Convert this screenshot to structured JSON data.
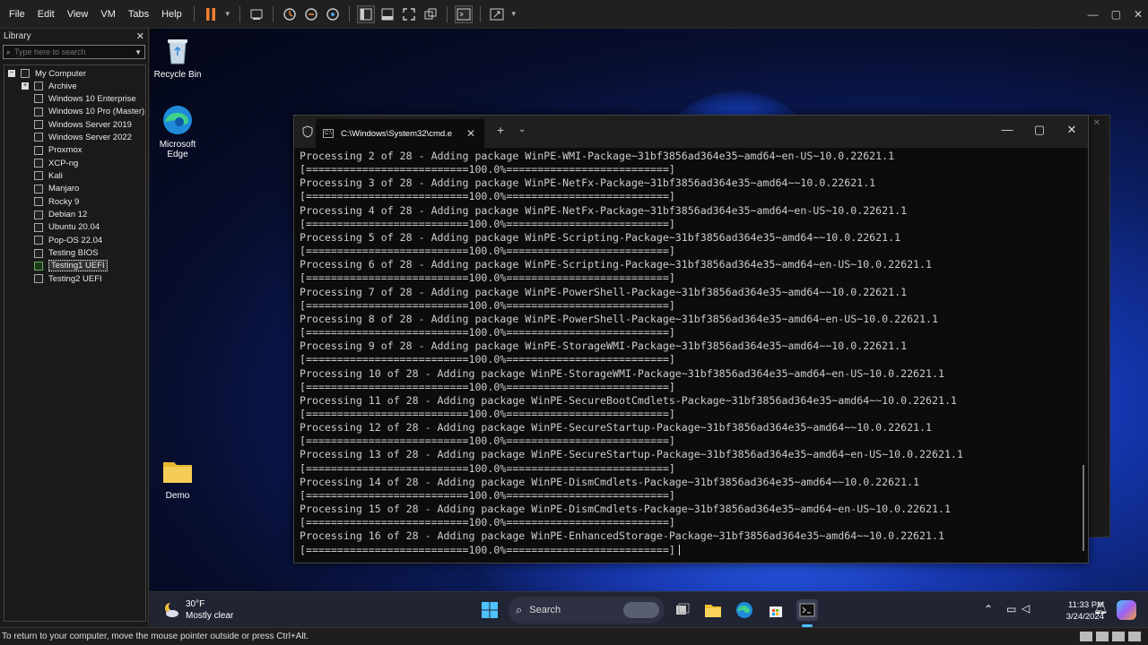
{
  "menubar": {
    "items": [
      "File",
      "Edit",
      "View",
      "VM",
      "Tabs",
      "Help"
    ]
  },
  "library": {
    "title": "Library",
    "search_placeholder": "Type here to search",
    "root": "My Computer",
    "items": [
      "Archive",
      "Windows 10 Enterprise",
      "Windows 10 Pro (Master)",
      "Windows Server 2019",
      "Windows Server 2022",
      "Proxmox",
      "XCP-ng",
      "Kali",
      "Manjaro",
      "Rocky 9",
      "Debian 12",
      "Ubuntu 20.04",
      "Pop-OS 22.04",
      "Testing BIOS",
      "Testing1 UEFI",
      "Testing2 UEFI"
    ],
    "selected": "Testing1 UEFI"
  },
  "desktop": {
    "icons": [
      "Recycle Bin",
      "Microsoft Edge",
      "Demo"
    ]
  },
  "terminal": {
    "tab_title": "C:\\Windows\\System32\\cmd.e",
    "lines": [
      "Processing 2 of 28 - Adding package WinPE-WMI-Package~31bf3856ad364e35~amd64~en-US~10.0.22621.1",
      "[==========================100.0%==========================]",
      "Processing 3 of 28 - Adding package WinPE-NetFx-Package~31bf3856ad364e35~amd64~~10.0.22621.1",
      "[==========================100.0%==========================]",
      "Processing 4 of 28 - Adding package WinPE-NetFx-Package~31bf3856ad364e35~amd64~en-US~10.0.22621.1",
      "[==========================100.0%==========================]",
      "Processing 5 of 28 - Adding package WinPE-Scripting-Package~31bf3856ad364e35~amd64~~10.0.22621.1",
      "[==========================100.0%==========================]",
      "Processing 6 of 28 - Adding package WinPE-Scripting-Package~31bf3856ad364e35~amd64~en-US~10.0.22621.1",
      "[==========================100.0%==========================]",
      "Processing 7 of 28 - Adding package WinPE-PowerShell-Package~31bf3856ad364e35~amd64~~10.0.22621.1",
      "[==========================100.0%==========================]",
      "Processing 8 of 28 - Adding package WinPE-PowerShell-Package~31bf3856ad364e35~amd64~en-US~10.0.22621.1",
      "[==========================100.0%==========================]",
      "Processing 9 of 28 - Adding package WinPE-StorageWMI-Package~31bf3856ad364e35~amd64~~10.0.22621.1",
      "[==========================100.0%==========================]",
      "Processing 10 of 28 - Adding package WinPE-StorageWMI-Package~31bf3856ad364e35~amd64~en-US~10.0.22621.1",
      "[==========================100.0%==========================]",
      "Processing 11 of 28 - Adding package WinPE-SecureBootCmdlets-Package~31bf3856ad364e35~amd64~~10.0.22621.1",
      "[==========================100.0%==========================]",
      "Processing 12 of 28 - Adding package WinPE-SecureStartup-Package~31bf3856ad364e35~amd64~~10.0.22621.1",
      "[==========================100.0%==========================]",
      "Processing 13 of 28 - Adding package WinPE-SecureStartup-Package~31bf3856ad364e35~amd64~en-US~10.0.22621.1",
      "[==========================100.0%==========================]",
      "Processing 14 of 28 - Adding package WinPE-DismCmdlets-Package~31bf3856ad364e35~amd64~~10.0.22621.1",
      "[==========================100.0%==========================]",
      "Processing 15 of 28 - Adding package WinPE-DismCmdlets-Package~31bf3856ad364e35~amd64~en-US~10.0.22621.1",
      "[==========================100.0%==========================]",
      "Processing 16 of 28 - Adding package WinPE-EnhancedStorage-Package~31bf3856ad364e35~amd64~~10.0.22621.1",
      "[==========================100.0%==========================]"
    ]
  },
  "taskbar": {
    "weather_temp": "30°F",
    "weather_desc": "Mostly clear",
    "search_label": "Search",
    "time": "11:33 PM",
    "date": "3/24/2024"
  },
  "statusbar": {
    "text": "To return to your computer, move the mouse pointer outside or press Ctrl+Alt."
  },
  "colors": {
    "accent_orange": "#f08030",
    "terminal_text": "#cccccc",
    "desktop_blue": "#1e55e8"
  }
}
